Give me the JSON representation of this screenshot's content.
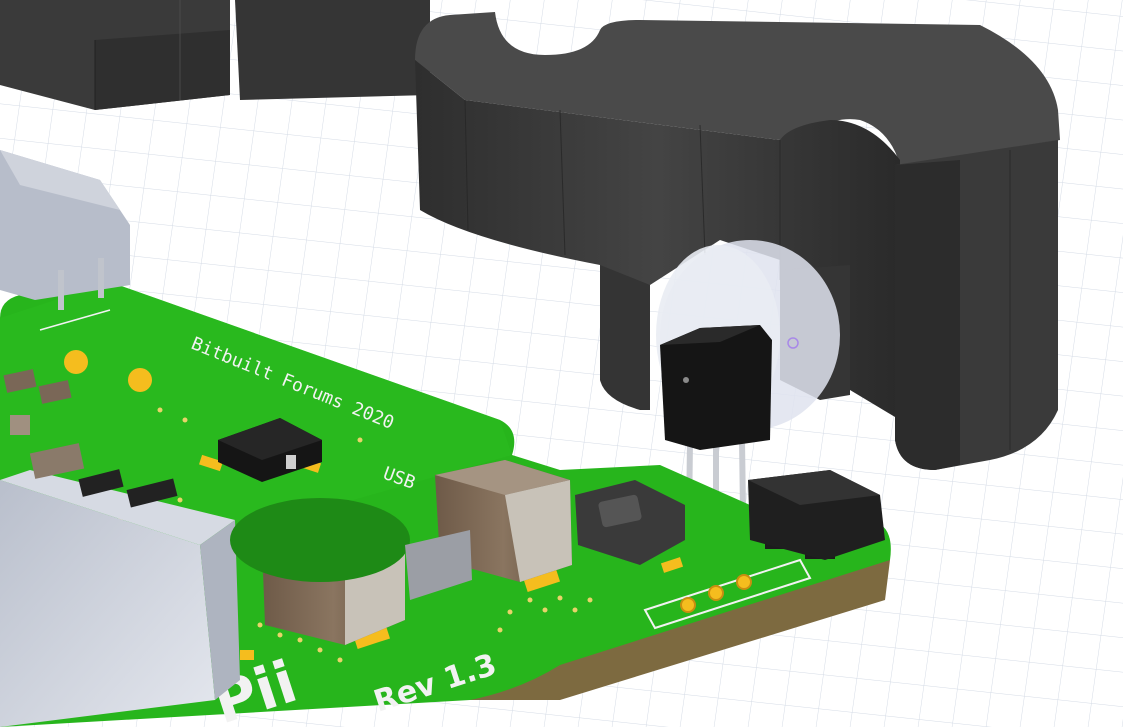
{
  "viewport": {
    "background": "#ffffff",
    "grid_color": "#d4dbe6"
  },
  "pcb": {
    "board_color": "#27b51c",
    "pad_color": "#f5bd1e",
    "silkscreen_color": "#f2f2f2",
    "text_forum": "Bitbuilt Forums 2020",
    "text_usb": "USB",
    "text_logo": "Pii",
    "text_rev": "Rev 1.3"
  },
  "bracket": {
    "color": "#3c3c3c"
  },
  "transistor": {
    "body_color": "#151515",
    "disc_color": "#dfe3ee"
  }
}
